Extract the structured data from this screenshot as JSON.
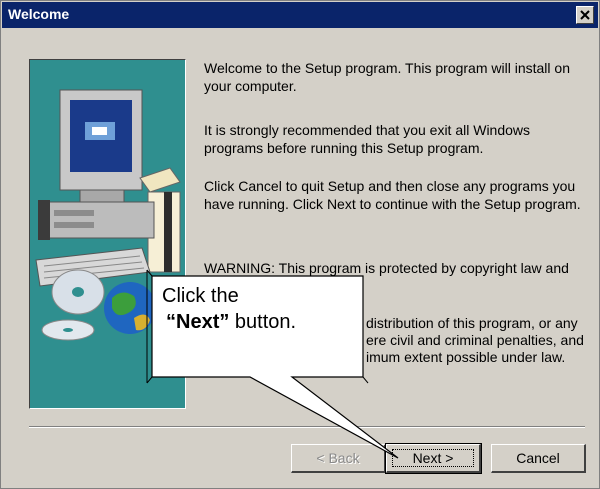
{
  "window": {
    "title": "Welcome"
  },
  "body": {
    "paragraph1": "Welcome to the  Setup program.  This program will install  on your computer.",
    "paragraph2": "It is strongly recommended that you exit all Windows programs before running this Setup program.",
    "paragraph3": "Click Cancel to quit Setup and then close any programs you have running.  Click Next to continue with the Setup program.",
    "warning_line": "WARNING: This program is protected by copyright law and",
    "hidden_line1": "distribution of this program, or any",
    "hidden_line2": "ere civil and criminal penalties, and",
    "hidden_line3": "imum extent possible under law."
  },
  "buttons": {
    "back": "< Back",
    "next": "Next >",
    "cancel": "Cancel"
  },
  "callout": {
    "line1": "Click the",
    "emph": "“Next”",
    "line2_rest": " button."
  },
  "colors": {
    "titlebar": "#0a246a",
    "dialog_face": "#d4d0c8",
    "art_background": "#2f8f8f",
    "callout_fill": "#ffffff"
  }
}
